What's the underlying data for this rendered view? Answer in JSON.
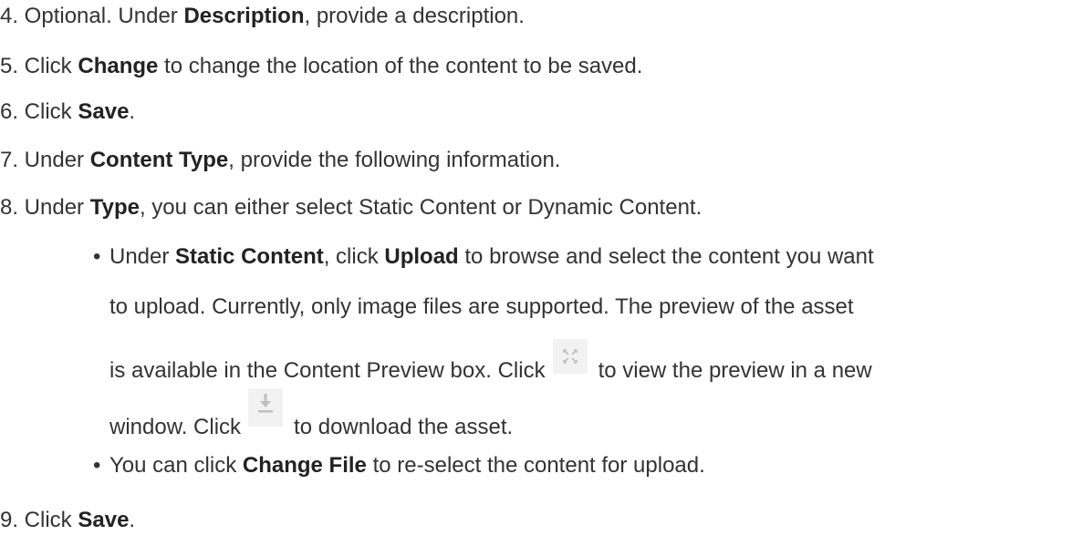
{
  "steps": {
    "s4": {
      "prefix": "4. Optional. Under ",
      "bold": "Description",
      "suffix": ", provide a description."
    },
    "s5": {
      "prefix": "5. Click ",
      "bold": "Change",
      "suffix": " to change the location of the content to be saved."
    },
    "s6": {
      "prefix": "6. Click ",
      "bold": "Save",
      "suffix": "."
    },
    "s7": {
      "prefix": "7. Under ",
      "bold": "Content Type",
      "suffix": ", provide the following information."
    },
    "s8": {
      "prefix": "8. Under ",
      "bold": "Type",
      "suffix": ", you can either select Static Content or Dynamic Content."
    },
    "s9": {
      "prefix": "9. Click ",
      "bold": "Save",
      "suffix": "."
    }
  },
  "bullets": {
    "static": {
      "bullet": "•",
      "p1": "Under ",
      "b1": "Static Content",
      "p2": ", click ",
      "b2": "Upload",
      "p3": " to browse and select the content you want",
      "line2": "to upload. Currently, only image files are supported. The preview of the asset",
      "line3_prefix": "is available in the Content Preview box. Click",
      "line3_suffix": "to view the preview in a new",
      "line4_prefix": "window. Click",
      "line4_suffix": "to download the asset."
    },
    "change_file": {
      "bullet": "•",
      "prefix": "You can click ",
      "bold": "Change File",
      "suffix": " to re-select the content for upload."
    }
  },
  "icons": {
    "expand": "expand-icon",
    "download": "download-icon",
    "icon_color": "#bfbfbf",
    "icon_bg": "#f2f2f2"
  }
}
